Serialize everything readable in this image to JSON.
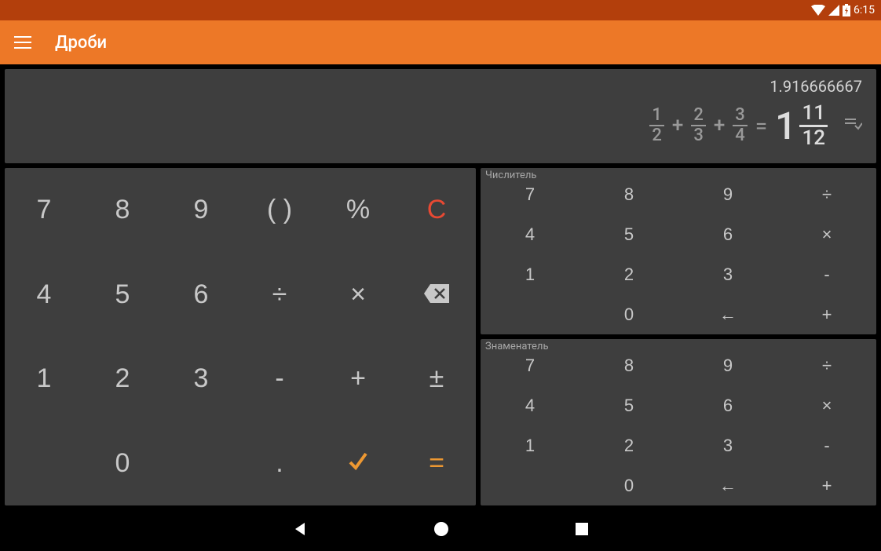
{
  "status": {
    "time": "6:15"
  },
  "app": {
    "title": "Дроби"
  },
  "display": {
    "decimal": "1.916666667",
    "f1n": "1",
    "f1d": "2",
    "f2n": "2",
    "f2d": "3",
    "f3n": "3",
    "f3d": "4",
    "plus": "+",
    "eq": "=",
    "whole": "1",
    "rn": "11",
    "rd": "12"
  },
  "keys": {
    "k7": "7",
    "k8": "8",
    "k9": "9",
    "paren": "( )",
    "pct": "%",
    "clear": "C",
    "k4": "4",
    "k5": "5",
    "k6": "6",
    "div": "÷",
    "mul": "×",
    "k1": "1",
    "k2": "2",
    "k3": "3",
    "minus": "-",
    "plus": "+",
    "pm": "±",
    "k0": "0",
    "dot": ".",
    "eq": "="
  },
  "numerator": {
    "label": "Числитель",
    "r": [
      "7",
      "8",
      "9",
      "÷",
      "4",
      "5",
      "6",
      "×",
      "1",
      "2",
      "3",
      "-",
      "",
      "0",
      "←",
      "+"
    ]
  },
  "denominator": {
    "label": "Знаменатель",
    "r": [
      "7",
      "8",
      "9",
      "÷",
      "4",
      "5",
      "6",
      "×",
      "1",
      "2",
      "3",
      "-",
      "",
      "0",
      "←",
      "+"
    ]
  }
}
